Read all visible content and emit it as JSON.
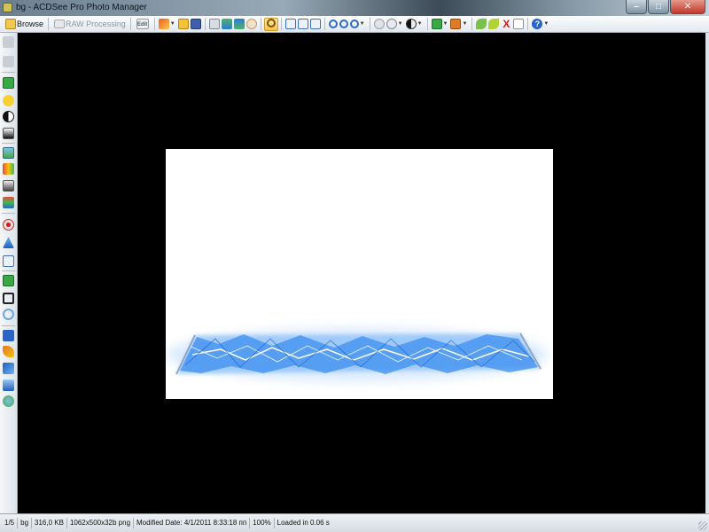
{
  "window": {
    "title": "bg - ACDSee Pro Photo Manager",
    "controls": {
      "minimize": "–",
      "maximize": "□",
      "close": "✕"
    }
  },
  "toolbar": {
    "browse_label": "Browse",
    "raw_label": "RAW Processing",
    "raw_icon_text": "Edit",
    "delete_symbol": "X",
    "help_symbol": "?"
  },
  "image": {
    "name": "bg"
  },
  "status": {
    "position": "1/5",
    "name": "bg",
    "size": "316,0 KB",
    "dimensions": "1062x500x32b png",
    "modified": "Modified Date: 4/1/2011 8:33:18 пп",
    "zoom": "100%",
    "loaded": "Loaded in 0.06 s"
  },
  "colors": {
    "canvas": "#000000",
    "image_bg": "#ffffff",
    "lightning": "#3d8ff0"
  }
}
